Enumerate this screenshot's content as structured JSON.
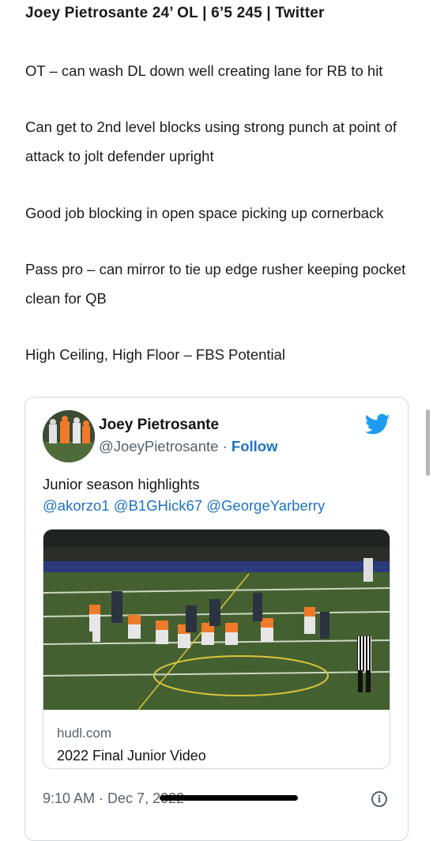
{
  "article": {
    "headline": "Joey Pietrosante 24’ OL | 6’5 245 | Twitter",
    "paragraphs": [
      "OT – can wash DL down well creating lane for RB to hit",
      "Can get to 2nd level blocks using strong punch at point of attack to jolt defender upright",
      "Good job blocking in open space picking up cornerback",
      "Pass pro – can mirror to tie up edge rusher keeping pocket clean for QB",
      "High Ceiling, High Floor – FBS Potential"
    ]
  },
  "tweet": {
    "display_name": "Joey Pietrosante",
    "handle": "@JoeyPietrosante",
    "separator": " · ",
    "follow_label": "Follow",
    "text": "Junior season highlights",
    "mentions": [
      "@akorzo1",
      "@B1GHick67",
      "@GeorgeYarberry"
    ],
    "link_card": {
      "domain": "hudl.com",
      "title": "2022 Final Junior Video"
    },
    "time": "9:10 AM",
    "date_partial": "Dec 7, 2022",
    "info_glyph": "i",
    "icons": [
      "twitter-bird-icon",
      "info-icon"
    ],
    "colors": {
      "link": "#1d73c4",
      "secondary": "#536471",
      "bird": "#1d9bf0"
    }
  }
}
